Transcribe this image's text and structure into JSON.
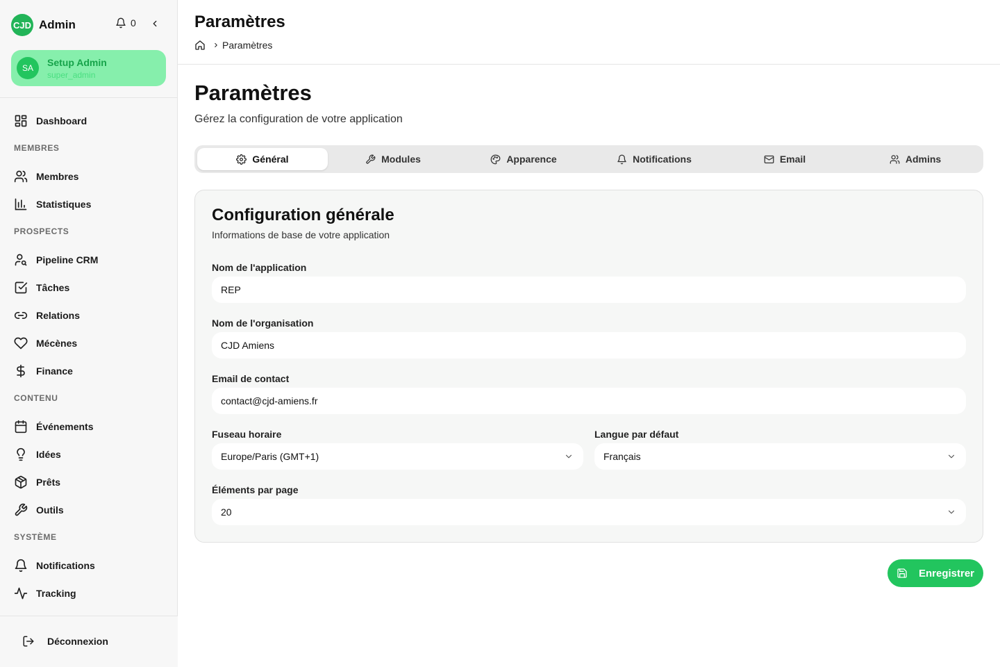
{
  "sidebar": {
    "logo_text": "CJD",
    "brand": "Admin",
    "notification_count": "0",
    "user": {
      "initials": "SA",
      "name": "Setup Admin",
      "role": "super_admin"
    },
    "nav": {
      "dashboard": "Dashboard",
      "section_membres": "MEMBRES",
      "membres": "Membres",
      "statistiques": "Statistiques",
      "section_prospects": "PROSPECTS",
      "pipeline": "Pipeline CRM",
      "taches": "Tâches",
      "relations": "Relations",
      "mecenes": "Mécènes",
      "finance": "Finance",
      "section_contenu": "CONTENU",
      "evenements": "Événements",
      "idees": "Idées",
      "prets": "Prêts",
      "outils": "Outils",
      "section_systeme": "SYSTÈME",
      "notifications": "Notifications",
      "tracking": "Tracking"
    },
    "logout": "Déconnexion"
  },
  "header": {
    "title": "Paramètres",
    "breadcrumb_current": "Paramètres"
  },
  "page": {
    "title": "Paramètres",
    "subtitle": "Gérez la configuration de votre application"
  },
  "tabs": {
    "general": "Général",
    "modules": "Modules",
    "apparence": "Apparence",
    "notifications": "Notifications",
    "email": "Email",
    "admins": "Admins"
  },
  "card": {
    "title": "Configuration générale",
    "subtitle": "Informations de base de votre application",
    "app_name_label": "Nom de l'application",
    "app_name_value": "REP",
    "org_label": "Nom de l'organisation",
    "org_value": "CJD Amiens",
    "email_label": "Email de contact",
    "email_value": "contact@cjd-amiens.fr",
    "timezone_label": "Fuseau horaire",
    "timezone_value": "Europe/Paris (GMT+1)",
    "language_label": "Langue par défaut",
    "language_value": "Français",
    "per_page_label": "Éléments par page",
    "per_page_value": "20"
  },
  "actions": {
    "save": "Enregistrer"
  },
  "colors": {
    "accent": "#22c55e",
    "accent_light": "#86efac"
  }
}
